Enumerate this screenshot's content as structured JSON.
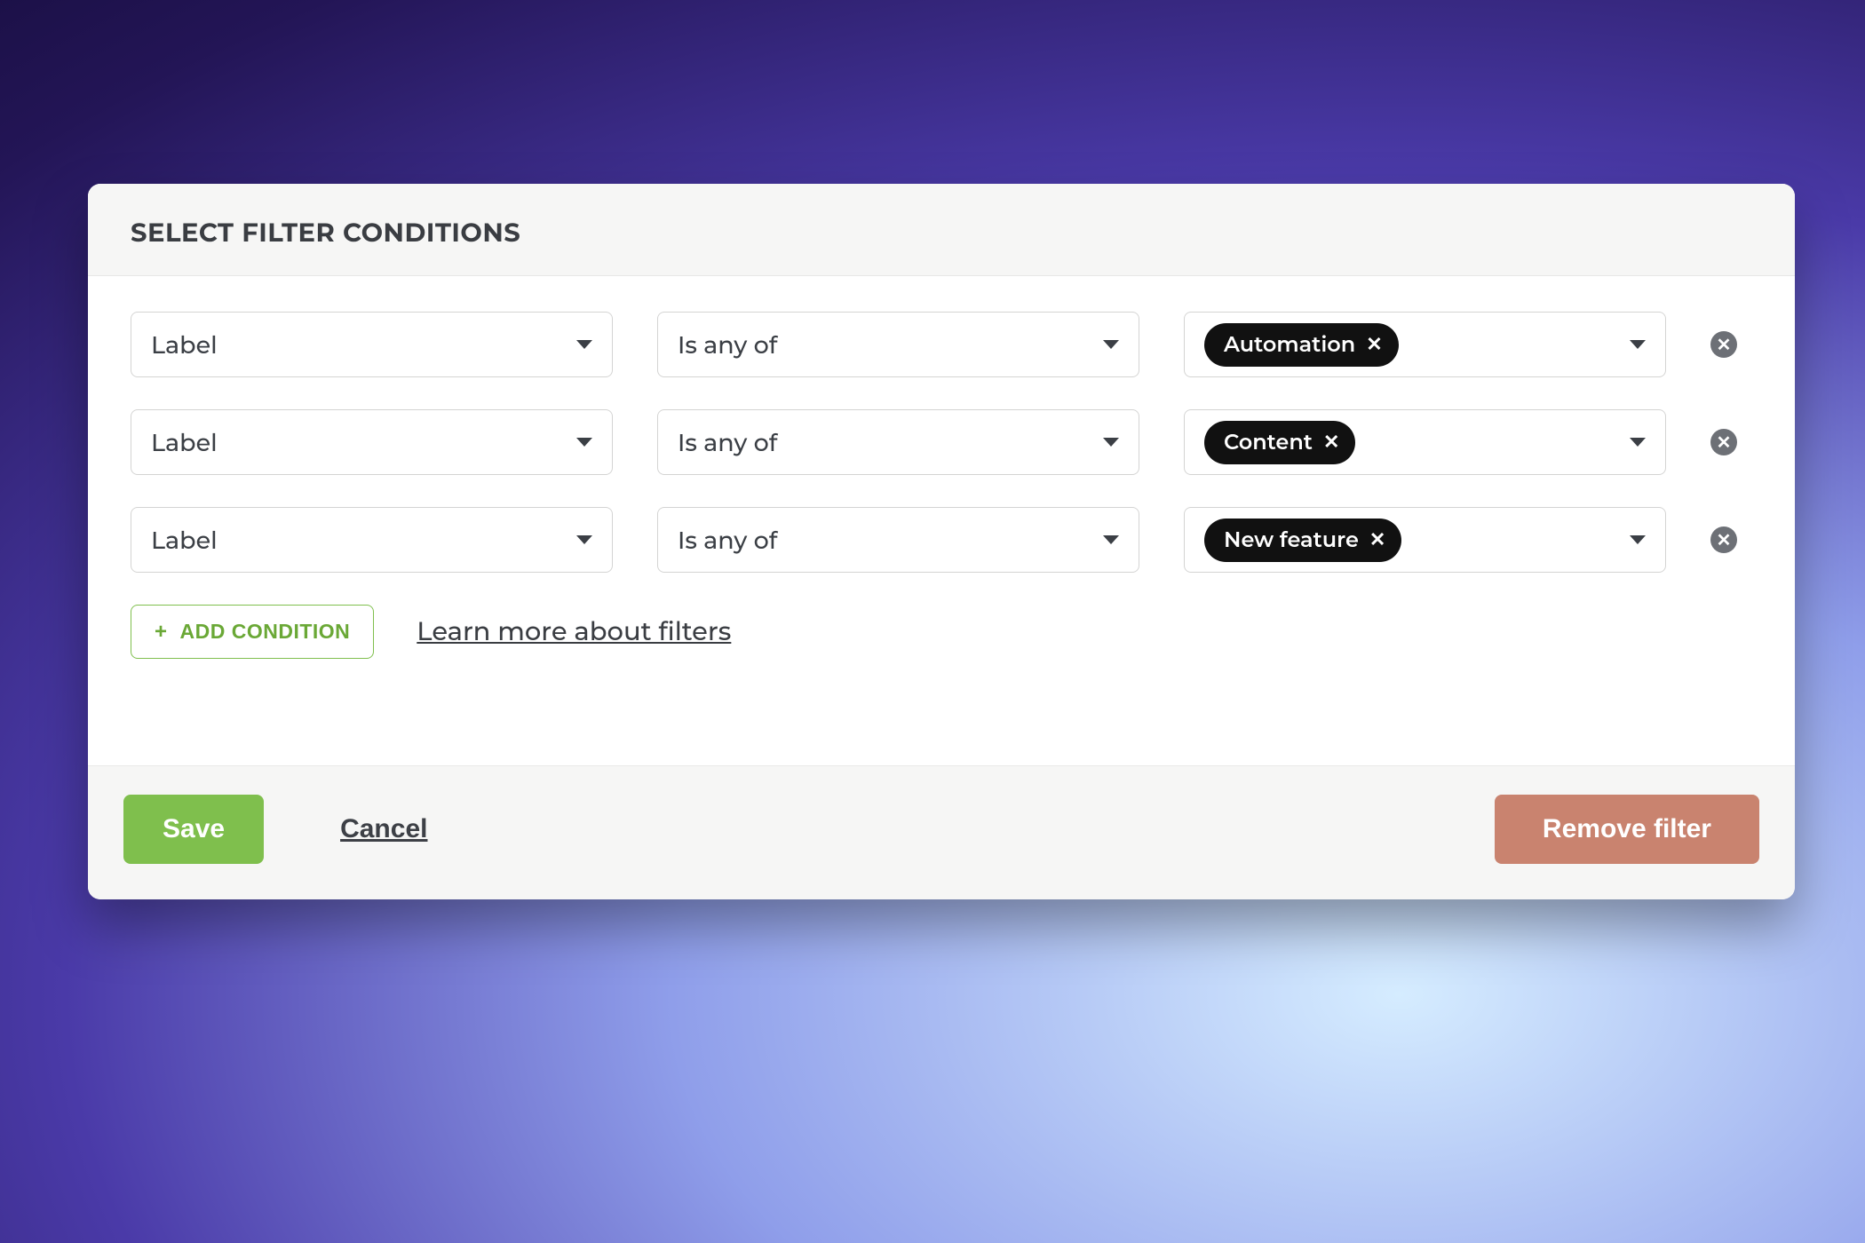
{
  "modal": {
    "title": "SELECT FILTER CONDITIONS"
  },
  "conditions": [
    {
      "field": "Label",
      "operator": "Is any of",
      "value": "Automation"
    },
    {
      "field": "Label",
      "operator": "Is any of",
      "value": "Content"
    },
    {
      "field": "Label",
      "operator": "Is any of",
      "value": "New feature"
    }
  ],
  "actions": {
    "add_condition_label": "ADD CONDITION",
    "learn_more_label": "Learn more about filters",
    "save_label": "Save",
    "cancel_label": "Cancel",
    "remove_filter_label": "Remove filter"
  },
  "colors": {
    "primary_green": "#7fbf4d",
    "danger": "#c9836f",
    "chip_bg": "#111111"
  }
}
